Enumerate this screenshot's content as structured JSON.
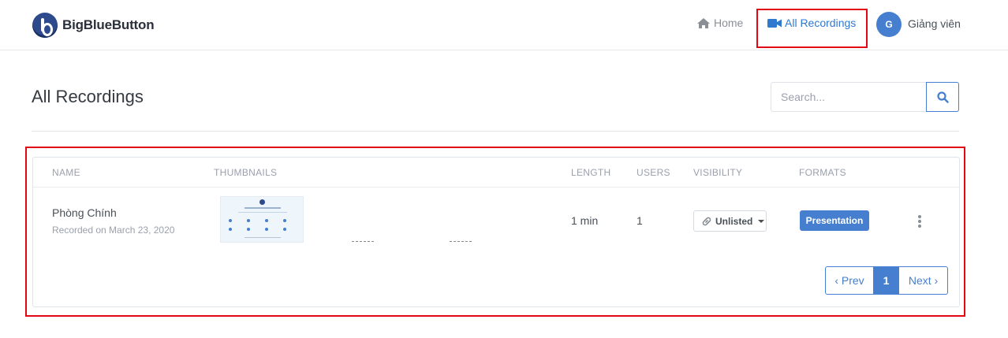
{
  "header": {
    "logo_text": "BigBlueButton",
    "nav": {
      "home_label": "Home",
      "home_icon": "home-icon",
      "recordings_label": "All Recordings",
      "recordings_icon": "video-camera-icon"
    },
    "user": {
      "avatar_initial": "G",
      "name": "Giảng viên"
    }
  },
  "page": {
    "title": "All Recordings",
    "search": {
      "placeholder": "Search...",
      "value": "",
      "icon": "search-icon"
    }
  },
  "table": {
    "columns": [
      "NAME",
      "THUMBNAILS",
      "LENGTH",
      "USERS",
      "VISIBILITY",
      "FORMATS"
    ],
    "rows": [
      {
        "name": "Phòng Chính",
        "recorded": "Recorded on March 23, 2020",
        "thumbnail": {
          "title": "Welcome To BigBlueButton"
        },
        "length": "1 min",
        "users": "1",
        "visibility": "Unlisted",
        "visibility_icon": "link-icon",
        "format": "Presentation",
        "actions_icon": "more-vertical-icon"
      }
    ]
  },
  "pagination": {
    "prev_label": "‹ Prev",
    "current_page": "1",
    "next_label": "Next ›"
  },
  "colors": {
    "primary": "#467fcf",
    "highlight": "#e30613",
    "muted": "#9aa0ac",
    "text": "#495057"
  }
}
